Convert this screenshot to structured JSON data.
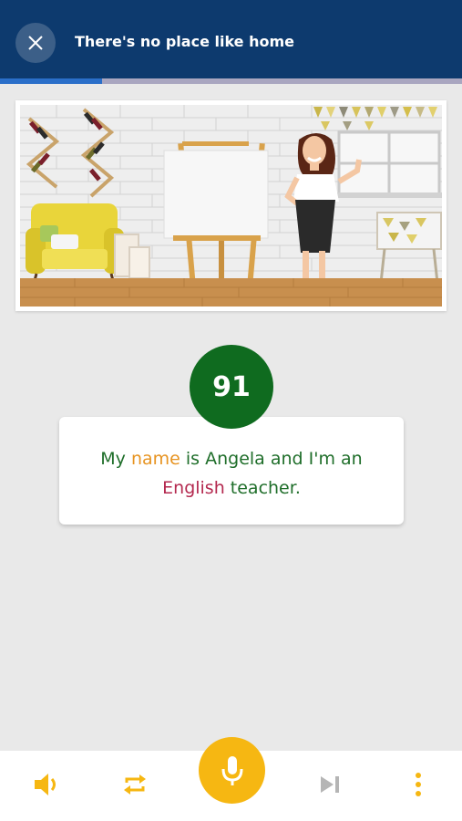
{
  "header": {
    "title": "There's no place like home",
    "progress_fraction": 0.22,
    "close_icon": "close-icon"
  },
  "score": {
    "value": "91"
  },
  "sentence": {
    "words": [
      {
        "text": "My ",
        "status": "correct"
      },
      {
        "text": "name",
        "status": "partial"
      },
      {
        "text": " is Angela and I'm an ",
        "status": "correct"
      },
      {
        "text": "English",
        "status": "wrong"
      },
      {
        "text": " teacher.",
        "status": "correct"
      }
    ]
  },
  "colors": {
    "header_bg": "#0d3a6e",
    "progress": "#2a6fc9",
    "score_bg": "#0f6b1f",
    "correct": "#1f6e2a",
    "partial": "#e79422",
    "wrong": "#b4294f",
    "accent": "#f6b712"
  },
  "toolbar": {
    "icons": [
      "speaker-icon",
      "repeat-icon",
      "microphone-icon",
      "skip-next-icon",
      "more-vertical-icon"
    ]
  }
}
